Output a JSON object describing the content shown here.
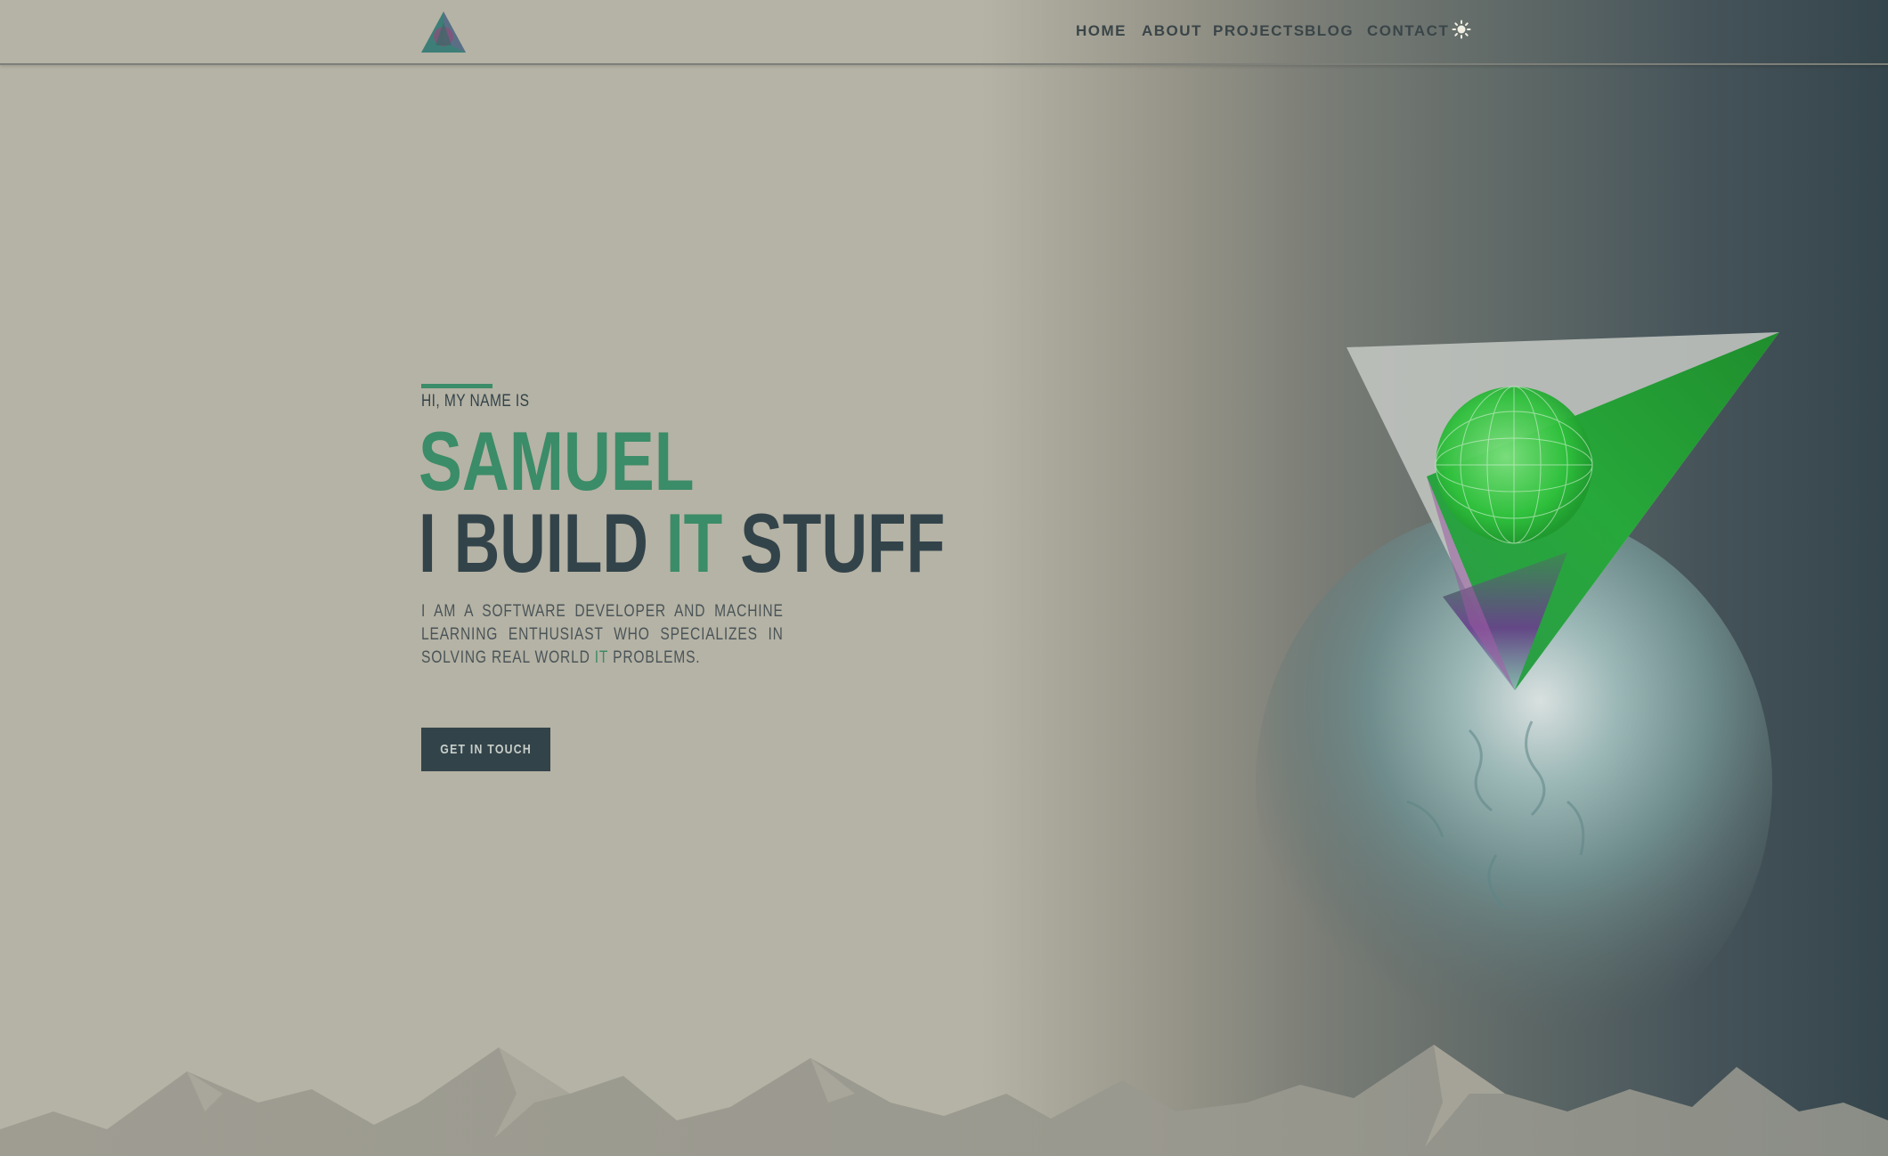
{
  "nav": {
    "items": [
      {
        "label": "HOME"
      },
      {
        "label": "ABOUT"
      },
      {
        "label": "PROJECTS"
      },
      {
        "label": "BLOG"
      },
      {
        "label": "CONTACT"
      }
    ],
    "theme_icon": "sun-icon"
  },
  "hero": {
    "intro": "HI, MY NAME IS",
    "name": "SAMUEL",
    "tagline_part1": "I BUILD ",
    "tagline_highlight": "IT",
    "tagline_part2": " STUFF",
    "description_part1": "I AM A SOFTWARE DEVELOPER AND MACHINE LEARNING ENTHUSIAST WHO SPECIALIZES IN SOLVING REAL WORLD ",
    "description_highlight": "IT",
    "description_part2": " PROBLEMS.",
    "cta_label": "GET IN TOUCH"
  },
  "colors": {
    "accent": "#3b8c68",
    "dark": "#33434a",
    "background": "#b5b3a5"
  }
}
